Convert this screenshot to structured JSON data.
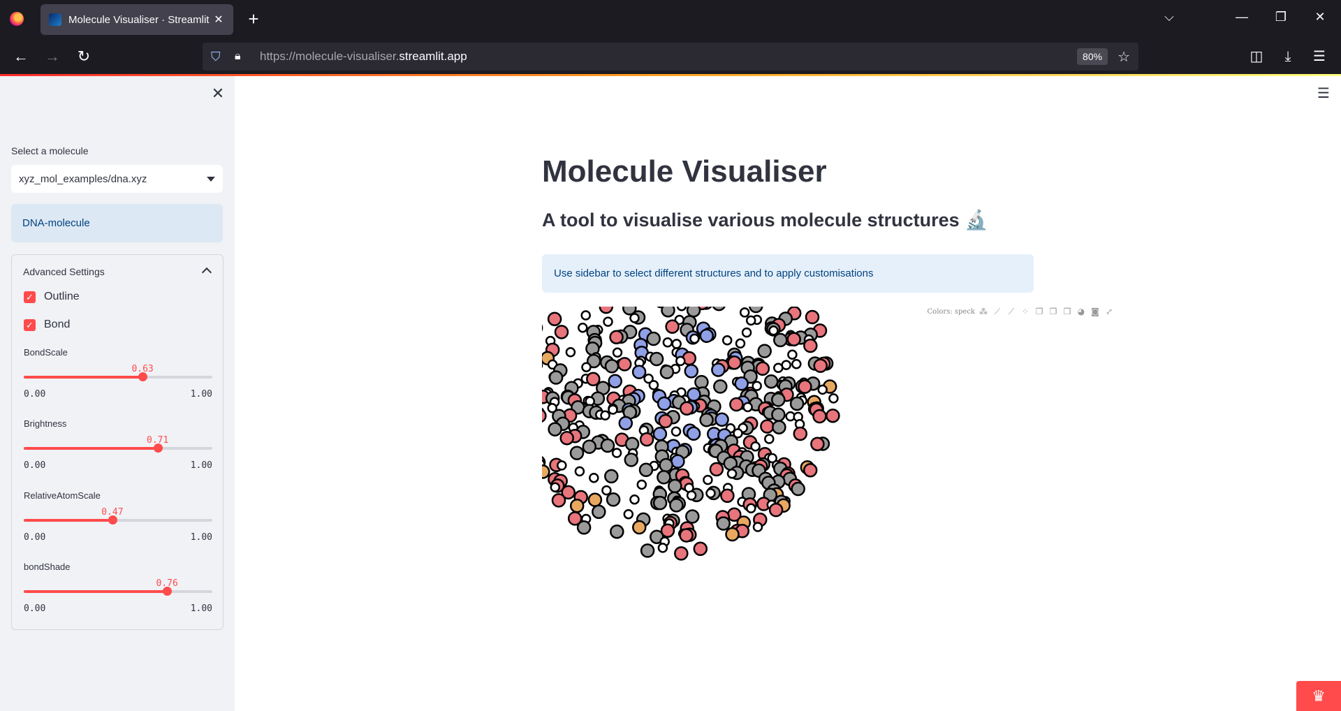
{
  "browser": {
    "tab_title": "Molecule Visualiser · Streamlit",
    "url_prefix": "https://molecule-visualiser.",
    "url_host": "streamlit.app",
    "zoom": "80%"
  },
  "sidebar": {
    "select_label": "Select a molecule",
    "select_value": "xyz_mol_examples/dna.xyz",
    "info": "DNA-molecule",
    "advanced_label": "Advanced Settings",
    "checkboxes": [
      {
        "label": "Outline",
        "checked": true
      },
      {
        "label": "Bond",
        "checked": true
      }
    ],
    "sliders": [
      {
        "name": "BondScale",
        "value": 0.63,
        "value_text": "0.63",
        "min": "0.00",
        "max": "1.00"
      },
      {
        "name": "Brightness",
        "value": 0.71,
        "value_text": "0.71",
        "min": "0.00",
        "max": "1.00"
      },
      {
        "name": "RelativeAtomScale",
        "value": 0.47,
        "value_text": "0.47",
        "min": "0.00",
        "max": "1.00"
      },
      {
        "name": "bondShade",
        "value": 0.76,
        "value_text": "0.76",
        "min": "0.00",
        "max": "1.00"
      }
    ]
  },
  "main": {
    "title": "Molecule Visualiser",
    "subtitle": "A tool to visualise various molecule structures 🔬",
    "info": "Use sidebar to select different structures and to apply customisations",
    "viewer_colors_label": "Colors: speck"
  },
  "colors": {
    "accent": "#ff4b4b",
    "atom_oxygen": "#e8747c",
    "atom_phosphorus": "#e8a860",
    "atom_nitrogen": "#8fa0e6",
    "atom_carbon": "#9a9a9a",
    "atom_hydrogen": "#ffffff"
  }
}
